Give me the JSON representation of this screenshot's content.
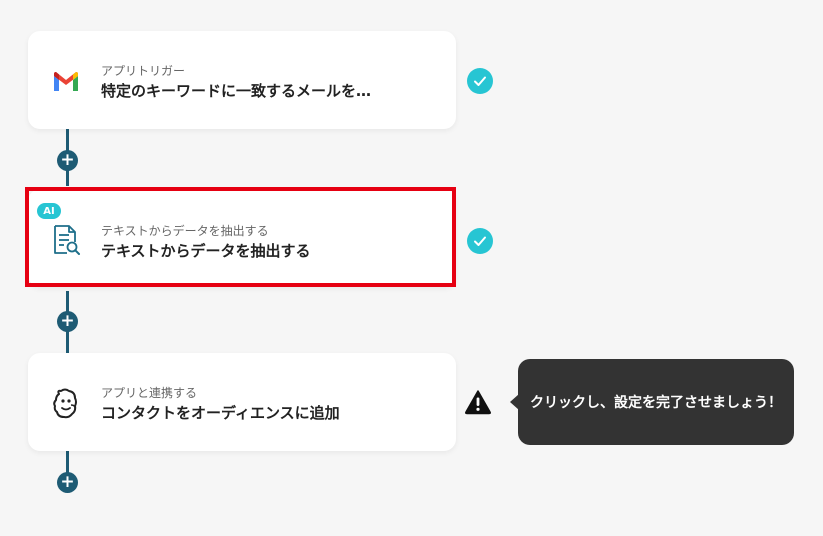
{
  "flow": {
    "steps": [
      {
        "subtitle": "アプリトリガー",
        "title": "特定のキーワードに一致するメールを…",
        "icon": "gmail-icon",
        "status": "completed"
      },
      {
        "badge": "AI",
        "subtitle": "テキストからデータを抽出する",
        "title": "テキストからデータを抽出する",
        "icon": "document-search-icon",
        "status": "completed",
        "highlighted": true
      },
      {
        "subtitle": "アプリと連携する",
        "title": "コンタクトをオーディエンスに追加",
        "icon": "mailchimp-icon",
        "status": "warning"
      }
    ],
    "add_step_icon": "plus-icon",
    "add_step_label": "+"
  },
  "tooltip": {
    "text": "クリックし、設定を完了させましょう！"
  },
  "colors": {
    "connector": "#1e5b74",
    "check": "#27c5d3",
    "highlight": "#e60012",
    "tooltip_bg": "#333333",
    "background": "#f6f6f6"
  }
}
